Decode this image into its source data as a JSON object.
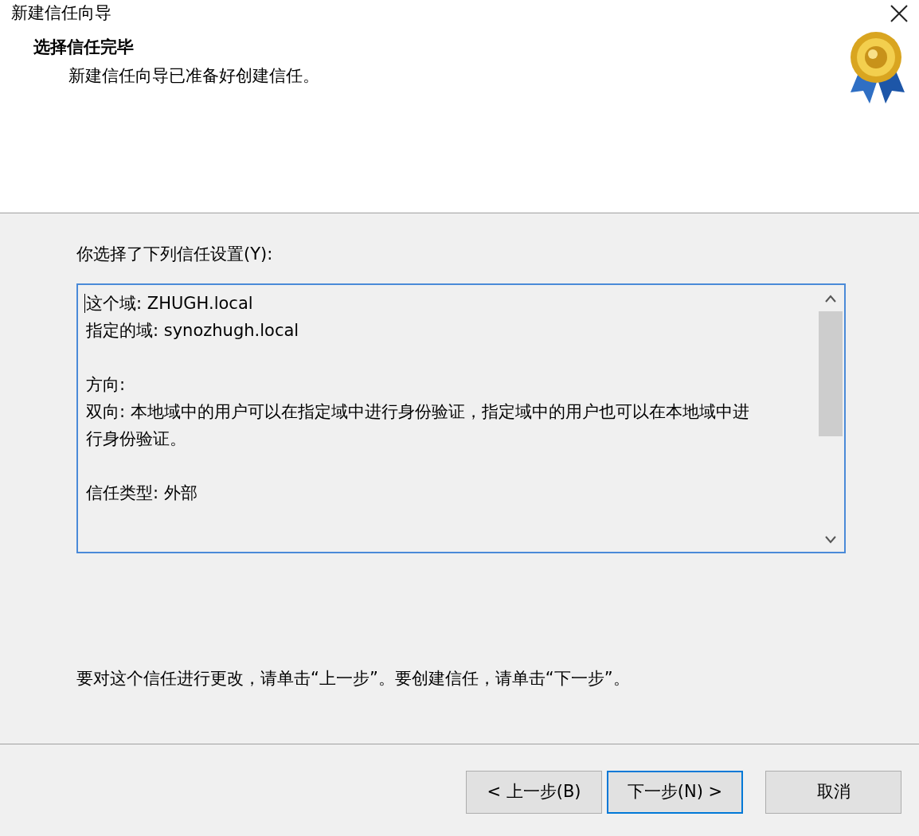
{
  "window": {
    "title": "新建信任向导"
  },
  "header": {
    "title": "选择信任完毕",
    "subtitle": "新建信任向导已准备好创建信任。"
  },
  "settings_label": "你选择了下列信任设置(Y):",
  "summary": {
    "paragraphs": [
      [
        "这个域: ZHUGH.local",
        "指定的域: synozhugh.local"
      ],
      [
        "方向:",
        "双向: 本地域中的用户可以在指定域中进行身份验证，指定域中的用户也可以在本地域中进行身份验证。"
      ],
      [
        "信任类型: 外部"
      ]
    ]
  },
  "instruction": "要对这个信任进行更改，请单击“上一步”。要创建信任，请单击“下一步”。",
  "buttons": [
    {
      "label": "< 上一步(B)",
      "default": false
    },
    {
      "label": "下一步(N) >",
      "default": true
    },
    {
      "label": "取消",
      "default": false
    }
  ]
}
